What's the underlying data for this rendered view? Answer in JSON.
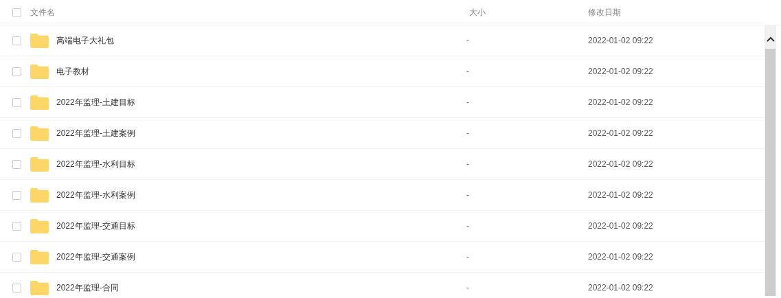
{
  "header": {
    "checked": false,
    "columns": [
      "文件名",
      "大小",
      "修改日期"
    ]
  },
  "rows": [
    {
      "name": "高端电子大礼包",
      "size": "-",
      "modified": "2022-01-02 09:22",
      "checked": false
    },
    {
      "name": "电子教材",
      "size": "-",
      "modified": "2022-01-02 09:22",
      "checked": false
    },
    {
      "name": "2022年监理-土建目标",
      "size": "-",
      "modified": "2022-01-02 09:22",
      "checked": false
    },
    {
      "name": "2022年监理-土建案例",
      "size": "-",
      "modified": "2022-01-02 09:22",
      "checked": false
    },
    {
      "name": "2022年监理-水利目标",
      "size": "-",
      "modified": "2022-01-02 09:22",
      "checked": false
    },
    {
      "name": "2022年监理-水利案例",
      "size": "-",
      "modified": "2022-01-02 09:22",
      "checked": false
    },
    {
      "name": "2022年监理-交通目标",
      "size": "-",
      "modified": "2022-01-02 09:22",
      "checked": false
    },
    {
      "name": "2022年监理-交通案例",
      "size": "-",
      "modified": "2022-01-02 09:22",
      "checked": false
    },
    {
      "name": "2022年监理-合同",
      "size": "-",
      "modified": "2022-01-02 09:22",
      "checked": false
    }
  ]
}
